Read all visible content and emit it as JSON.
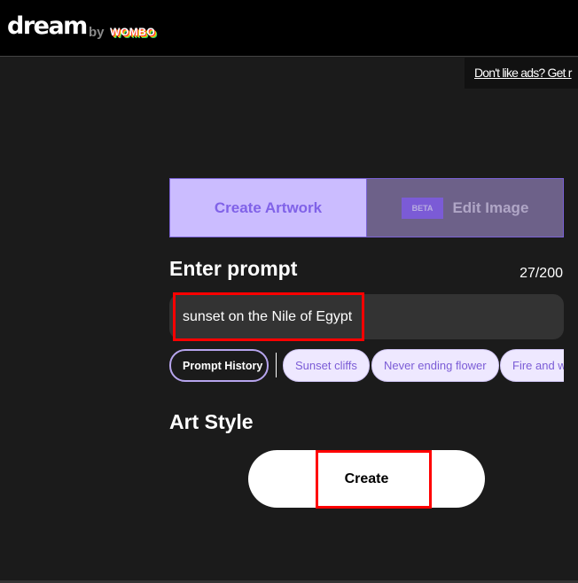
{
  "header": {
    "logo": "dream",
    "by": "by",
    "brand": "WOMBO"
  },
  "ad": {
    "link": "Don't like ads? Get r"
  },
  "tabs": {
    "create": "Create Artwork",
    "edit": "Edit Image",
    "beta": "BETA"
  },
  "prompt": {
    "heading": "Enter prompt",
    "count": "27/200",
    "value": "sunset on the Nile of Egypt"
  },
  "chips": [
    "Prompt History",
    "Sunset cliffs",
    "Never ending flower",
    "Fire and w"
  ],
  "art_style": {
    "heading": "Art Style"
  },
  "create_button": "Create",
  "colors": {
    "accent": "#7b5cd6",
    "tab_active": "#cbbcff",
    "tab_inactive": "#6d6189",
    "annotation": "#ff0000"
  }
}
